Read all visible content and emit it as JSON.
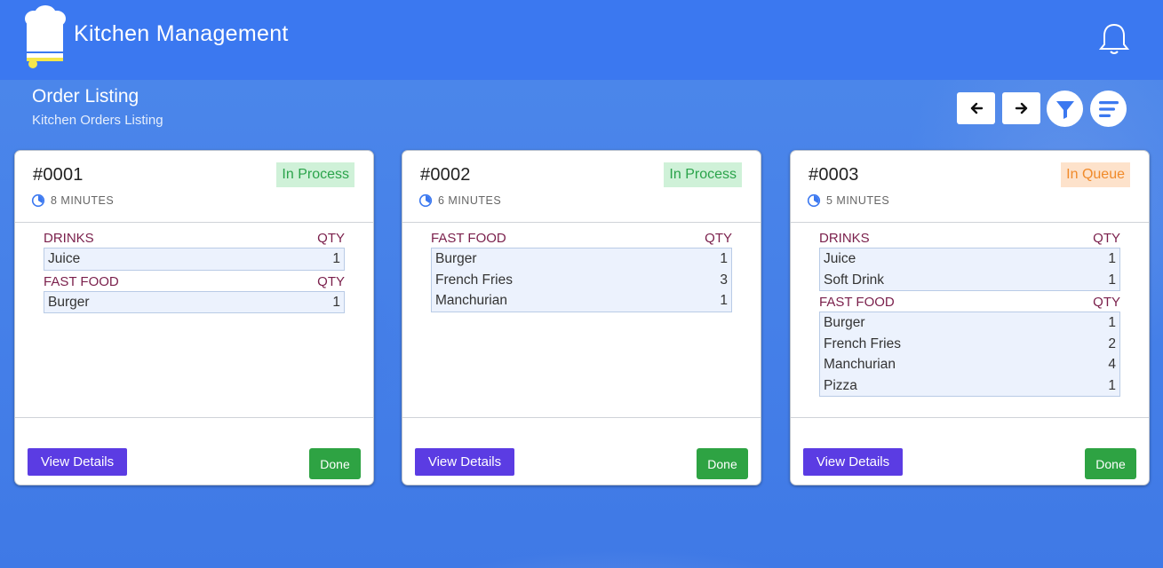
{
  "header": {
    "title": "Kitchen Management",
    "logo_icon": "chef-hat-icon",
    "bell_icon": "bell-icon"
  },
  "page": {
    "title": "Order Listing",
    "subtitle": "Kitchen Orders Listing"
  },
  "toolbar": {
    "prev_icon": "arrow-left-icon",
    "next_icon": "arrow-right-icon",
    "filter_icon": "filter-icon",
    "sort_icon": "sort-lines-icon"
  },
  "colors": {
    "accent": "#3b78f0",
    "view_button": "#5b3ce3",
    "done_button": "#2ea343",
    "in_process": "#2aa34a",
    "in_queue": "#f08a2a",
    "category": "#7a1f4b"
  },
  "orders": [
    {
      "number": "#0001",
      "status": "In Process",
      "status_type": "process",
      "time": "8 MINUTES",
      "sections": [
        {
          "category": "DRINKS",
          "qty_label": "QTY",
          "items": [
            {
              "name": "Juice",
              "qty": "1"
            }
          ]
        },
        {
          "category": "FAST FOOD",
          "qty_label": "QTY",
          "items": [
            {
              "name": "Burger",
              "qty": "1"
            }
          ]
        }
      ],
      "view_label": "View Details",
      "done_label": "Done"
    },
    {
      "number": "#0002",
      "status": "In Process",
      "status_type": "process",
      "time": "6 MINUTES",
      "sections": [
        {
          "category": "FAST FOOD",
          "qty_label": "QTY",
          "items": [
            {
              "name": "Burger",
              "qty": "1"
            },
            {
              "name": "French Fries",
              "qty": "3"
            },
            {
              "name": "Manchurian",
              "qty": "1"
            }
          ]
        }
      ],
      "view_label": "View Details",
      "done_label": "Done"
    },
    {
      "number": "#0003",
      "status": "In Queue",
      "status_type": "queue",
      "time": "5 MINUTES",
      "sections": [
        {
          "category": "DRINKS",
          "qty_label": "QTY",
          "items": [
            {
              "name": "Juice",
              "qty": "1"
            },
            {
              "name": "Soft Drink",
              "qty": "1"
            }
          ]
        },
        {
          "category": "FAST FOOD",
          "qty_label": "QTY",
          "items": [
            {
              "name": "Burger",
              "qty": "1"
            },
            {
              "name": "French Fries",
              "qty": "2"
            },
            {
              "name": "Manchurian",
              "qty": "4"
            },
            {
              "name": "Pizza",
              "qty": "1"
            }
          ]
        }
      ],
      "view_label": "View Details",
      "done_label": "Done"
    }
  ]
}
